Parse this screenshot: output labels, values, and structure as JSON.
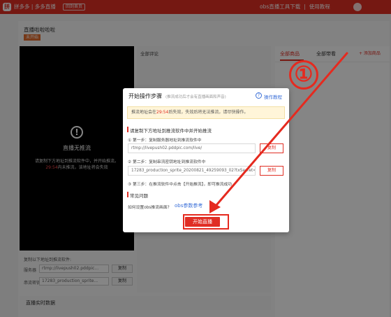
{
  "topbar": {
    "logo_glyph": "拼",
    "brand": "拼多多 | 多多直播",
    "back_home": "回到首页",
    "links": [
      "obs直播工具下载",
      "使用教程"
    ],
    "accent_color": "#e02e24"
  },
  "room": {
    "title": "直播啦啦啦啦",
    "status": "未开始"
  },
  "video": {
    "icon": "warning-circle-icon",
    "title": "直播无推流",
    "message_line1": "请复制下方地址到推流软件中，并开始推流。",
    "countdown": "29:54",
    "message_line2": "内未推流，该地址将会失效"
  },
  "copy_area": {
    "label": "复制以下地址到推流软件:",
    "server_label": "服务器",
    "server_value": "rtmp://livepush02.pddpic...",
    "key_label": "串流密钥",
    "key_value": "17283_production_sprite...",
    "copy_label": "复制"
  },
  "comments": {
    "title": "全部评论"
  },
  "realtime": {
    "title": "直播实时数据"
  },
  "right_panel": {
    "tabs": [
      "全部商品",
      "全部带看"
    ],
    "add_goods": "+ 添加商品"
  },
  "dialog": {
    "title": "开始操作步骤",
    "subtitle": "(推流成功后才会有直播画面和声音)",
    "help_label": "操作教程",
    "notice_prefix": "推流地址会在",
    "notice_countdown": "29:54",
    "notice_suffix": "后失效，失效后将无法推流，请尽快操作。",
    "section1_title": "请复制下方地址到推流软件中并开始推流",
    "step1": "① 第一步：复制服务器地址到推流软件中",
    "server_url": "rtmp://livepush02.pddpic.com/live/",
    "step2": "② 第二步：复制串流密钥地址到推流软件中",
    "stream_key": "17283_production_sprite_20200821_49259093_02?txSecret=",
    "step3": "③ 第三步：在推流软件中点击【开始推流】，即可推流成功",
    "copy_label": "复制",
    "section2_title": "常见问题",
    "faq_question": "如何设置obs推流画面?",
    "faq_link": "obs参数参考",
    "start_button": "开始直播"
  },
  "annotation": {
    "number": "①",
    "color": "#e52a1f"
  }
}
